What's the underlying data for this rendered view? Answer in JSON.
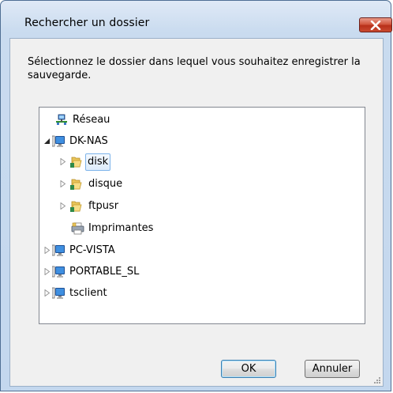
{
  "window": {
    "title": "Rechercher un dossier",
    "close_icon": "close-icon"
  },
  "instructions": "Sélectionnez le dossier dans lequel vous souhaitez enregistrer la sauvegarde.",
  "tree": {
    "nodes": [
      {
        "label": "Réseau",
        "icon": "network-icon",
        "level": 0,
        "expander": "none",
        "selected": false
      },
      {
        "label": "DK-NAS",
        "icon": "computer-icon",
        "level": 0,
        "expander": "expanded",
        "selected": false
      },
      {
        "label": "disk",
        "icon": "folder-icon",
        "level": 1,
        "expander": "collapsed",
        "selected": true
      },
      {
        "label": "disque",
        "icon": "folder-icon",
        "level": 1,
        "expander": "collapsed",
        "selected": false
      },
      {
        "label": "ftpusr",
        "icon": "folder-icon",
        "level": 1,
        "expander": "collapsed",
        "selected": false
      },
      {
        "label": "Imprimantes",
        "icon": "printer-icon",
        "level": 1,
        "expander": "none",
        "selected": false
      },
      {
        "label": "PC-VISTA",
        "icon": "computer-icon",
        "level": 0,
        "expander": "collapsed",
        "selected": false
      },
      {
        "label": "PORTABLE_SL",
        "icon": "computer-icon",
        "level": 0,
        "expander": "collapsed",
        "selected": false
      },
      {
        "label": "tsclient",
        "icon": "computer-icon",
        "level": 0,
        "expander": "collapsed",
        "selected": false
      }
    ]
  },
  "buttons": {
    "ok": "OK",
    "cancel": "Annuler"
  }
}
